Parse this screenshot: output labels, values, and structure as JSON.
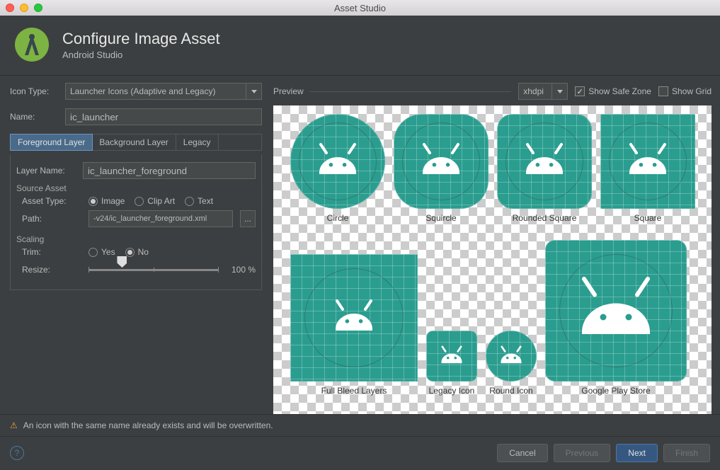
{
  "window": {
    "title": "Asset Studio"
  },
  "header": {
    "title": "Configure Image Asset",
    "subtitle": "Android Studio"
  },
  "form": {
    "icon_type_label": "Icon Type:",
    "icon_type_value": "Launcher Icons (Adaptive and Legacy)",
    "name_label": "Name:",
    "name_value": "ic_launcher",
    "tabs": [
      "Foreground Layer",
      "Background Layer",
      "Legacy"
    ],
    "active_tab": 0,
    "layer_name_label": "Layer Name:",
    "layer_name_value": "ic_launcher_foreground",
    "source_asset_label": "Source Asset",
    "asset_type_label": "Asset Type:",
    "asset_types": [
      "Image",
      "Clip Art",
      "Text"
    ],
    "asset_type_selected": 0,
    "path_label": "Path:",
    "path_value": "-v24/ic_launcher_foreground.xml",
    "browse_label": "...",
    "scaling_label": "Scaling",
    "trim_label": "Trim:",
    "trim_options": [
      "Yes",
      "No"
    ],
    "trim_selected": 1,
    "resize_label": "Resize:",
    "resize_value": "100 %"
  },
  "preview": {
    "label": "Preview",
    "density": "xhdpi",
    "show_safe_zone_label": "Show Safe Zone",
    "show_safe_zone": true,
    "show_grid_label": "Show Grid",
    "show_grid": false,
    "shapes_row1": [
      "Circle",
      "Squircle",
      "Rounded Square",
      "Square"
    ],
    "shapes_row2": [
      "Full Bleed Layers",
      "Legacy Icon",
      "Round Icon",
      "Google Play Store"
    ]
  },
  "warning": "An icon with the same name already exists and will be overwritten.",
  "footer": {
    "cancel": "Cancel",
    "previous": "Previous",
    "next": "Next",
    "finish": "Finish"
  },
  "colors": {
    "accent": "#2a9d8f"
  }
}
